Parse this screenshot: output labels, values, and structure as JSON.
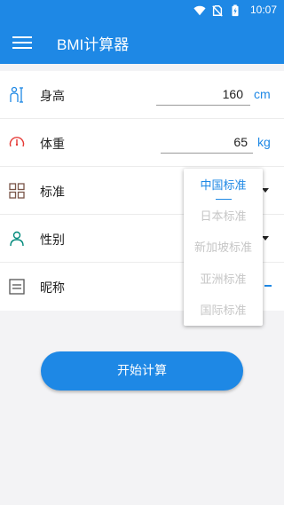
{
  "status": {
    "time": "10:07",
    "icons": [
      "wifi-icon",
      "no-sim-icon",
      "battery-charging-icon"
    ]
  },
  "appbar": {
    "title": "BMI计算器",
    "menu_icon": "menu-icon"
  },
  "colors": {
    "primary": "#1e88e5",
    "background": "#f3f3f5"
  },
  "form": {
    "height": {
      "label": "身高",
      "value": "160",
      "unit": "cm",
      "icon": "height-person-icon"
    },
    "weight": {
      "label": "体重",
      "value": "65",
      "unit": "kg",
      "icon": "gauge-icon"
    },
    "standard": {
      "label": "标准",
      "icon": "grid-icon"
    },
    "gender": {
      "label": "性别",
      "icon": "person-icon"
    },
    "nickname": {
      "label": "昵称",
      "icon": "list-box-icon"
    }
  },
  "dropdown": {
    "options": [
      "中国标准",
      "日本标准",
      "新加坡标准",
      "亚洲标准",
      "国际标准"
    ],
    "selected": "中国标准"
  },
  "actions": {
    "start": "开始计算"
  }
}
